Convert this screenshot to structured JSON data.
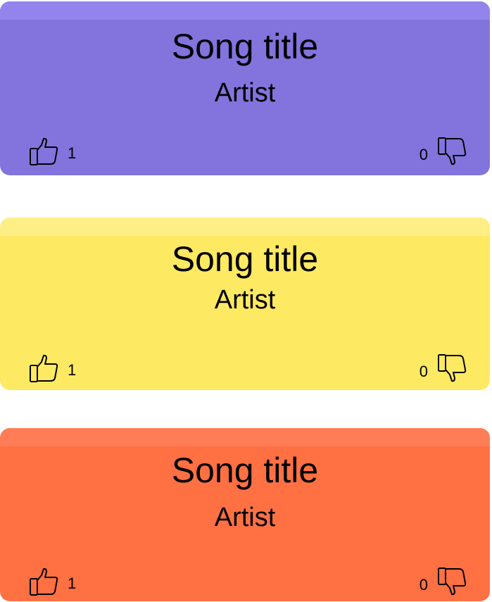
{
  "cards": [
    {
      "title": "Song title",
      "artist": "Artist",
      "likes": "1",
      "dislikes": "0",
      "color": "#8373DD",
      "band_color": "#9383EC"
    },
    {
      "title": "Song title",
      "artist": "Artist",
      "likes": "1",
      "dislikes": "0",
      "color": "#FEE963",
      "band_color": "#FEEE86"
    },
    {
      "title": "Song title",
      "artist": "Artist",
      "likes": "1",
      "dislikes": "0",
      "color": "#FF7043",
      "band_color": "#FF7D56"
    }
  ],
  "icons": {
    "like": "thumbs-up-icon",
    "dislike": "thumbs-down-icon"
  }
}
